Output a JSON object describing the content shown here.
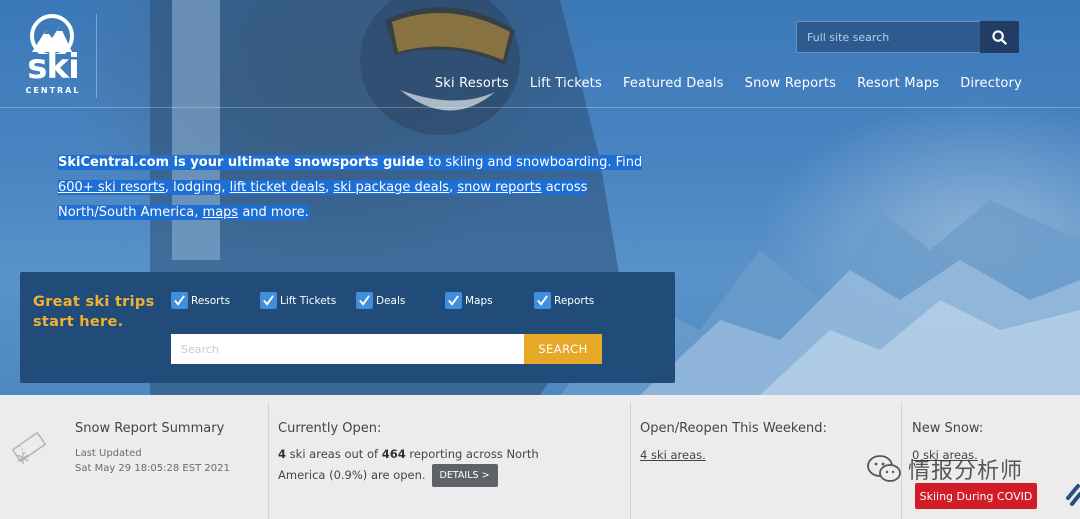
{
  "logo": {
    "word": "ski",
    "sub": "CENTRAL"
  },
  "header": {
    "search_placeholder": "Full site search",
    "nav": [
      "Ski Resorts",
      "Lift Tickets",
      "Featured Deals",
      "Snow Reports",
      "Resort Maps",
      "Directory"
    ]
  },
  "intro": {
    "lead": "SkiCentral.com is your ultimate snowsports guide",
    "t1": " to skiing and snowboarding. Find ",
    "l1": "600+ ski resorts",
    "t2": ", lodging, ",
    "l2": "lift ticket deals",
    "t3": ", ",
    "l3": "ski package deals",
    "t4": ", ",
    "l4": "snow reports",
    "t5": " across North/South America, ",
    "l5": "maps",
    "t6": " and more."
  },
  "search_panel": {
    "title": "Great ski trips start here.",
    "checkboxes": [
      "Resorts",
      "Lift Tickets",
      "Deals",
      "Maps",
      "Reports"
    ],
    "input_placeholder": "Search",
    "button": "SEARCH"
  },
  "snow_strip": {
    "summary_title": "Snow Report Summary",
    "last_updated_label": "Last Updated",
    "last_updated_value": "Sat May 29 18:05:28 EST 2021",
    "open_title": "Currently Open:",
    "open_count": "4",
    "open_t1": " ski areas out of ",
    "open_total": "464",
    "open_t2": " reporting across North America (0.9%) are open.",
    "details_btn": "DETAILS >",
    "weekend_title": "Open/Reopen This Weekend:",
    "weekend_link": "4 ski areas.",
    "newsnow_title": "New Snow:",
    "newsnow_value": "0 ski areas."
  },
  "covid_button": "Skiing During COVID",
  "watermark": "情报分析师",
  "colors": {
    "accent_gold": "#e8a827",
    "panel_blue": "#214c7a",
    "covid_red": "#d11d27"
  }
}
